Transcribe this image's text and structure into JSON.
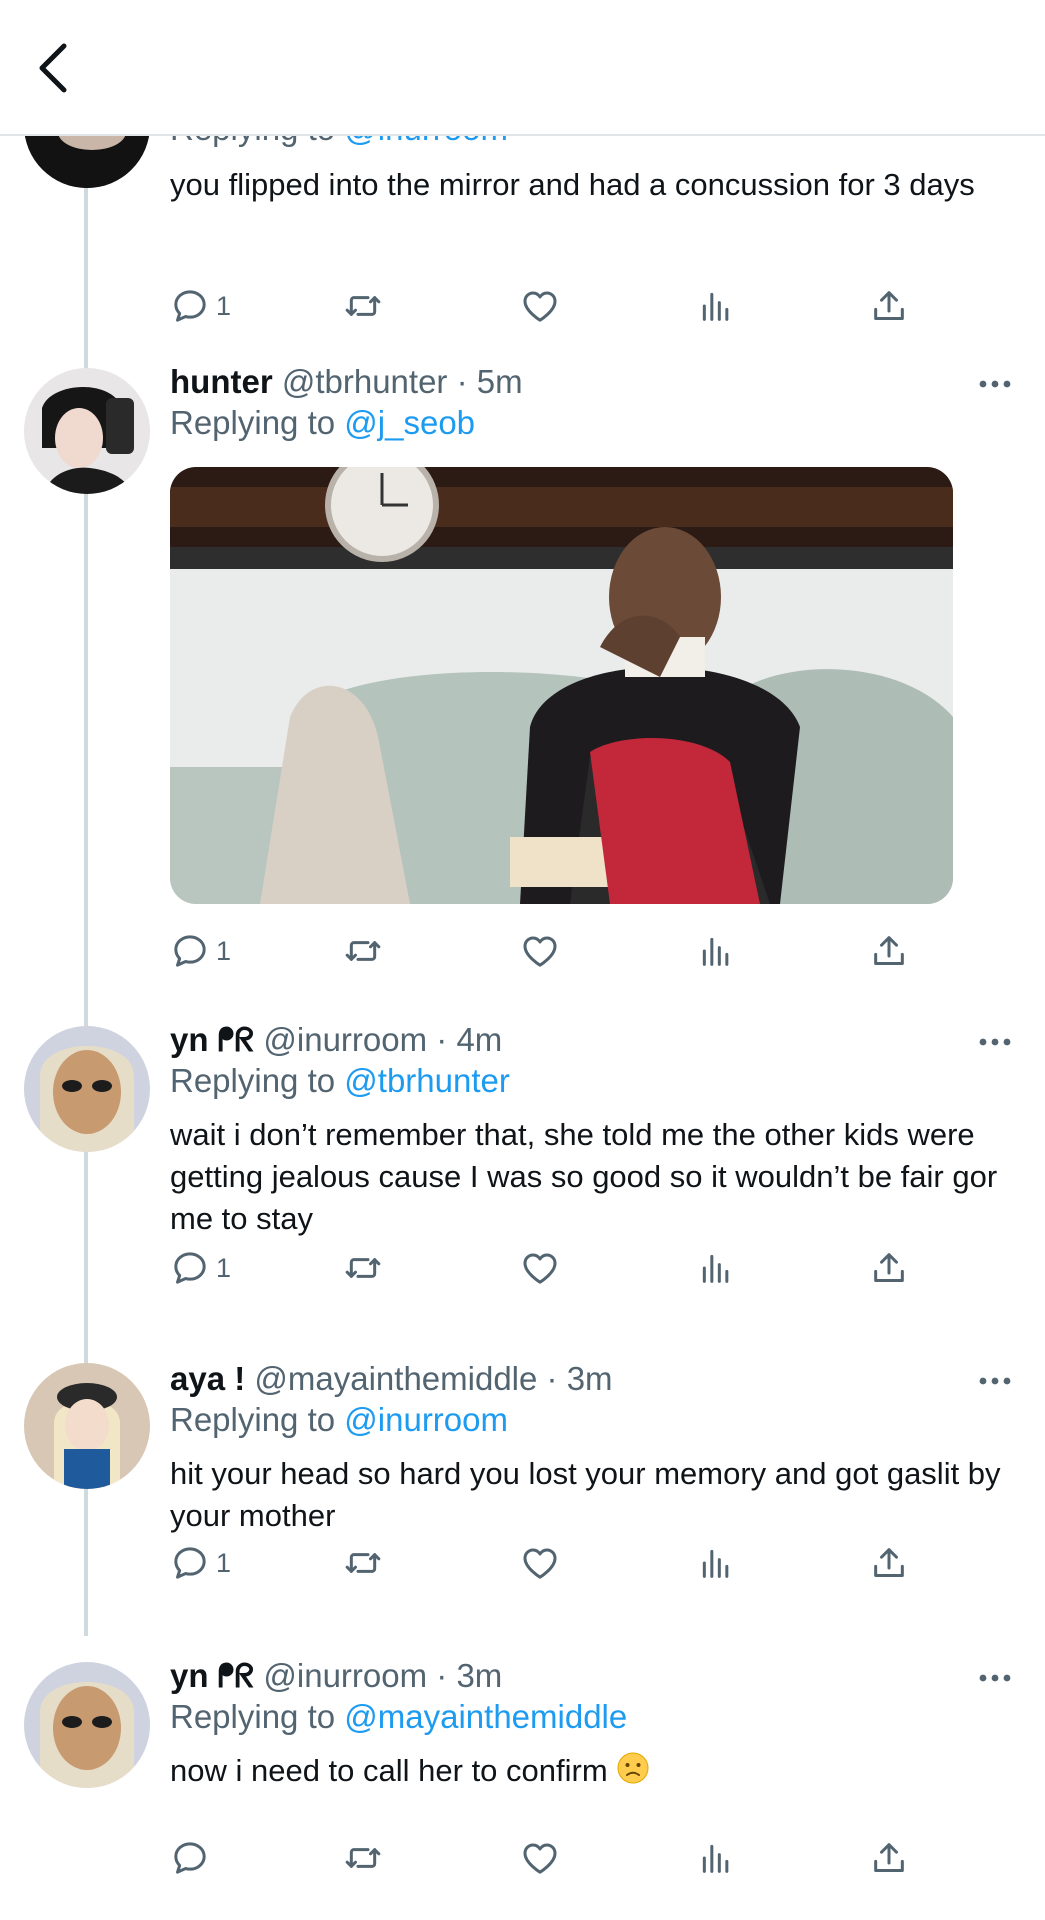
{
  "tweets": [
    {
      "reply_prefix": "Replying to",
      "reply_handle": "@inurroom",
      "text": "you flipped into the mirror and had a concussion for 3 days",
      "reply_count": "1"
    },
    {
      "name": "hunter",
      "handle": "@tbrhunter",
      "time": "· 5m",
      "reply_prefix": "Replying to",
      "reply_handle": "@j_seob",
      "reply_count": "1"
    },
    {
      "name": "yn ᖰᖇ",
      "handle": "@inurroom",
      "time": "· 4m",
      "reply_prefix": "Replying to",
      "reply_handle": "@tbrhunter",
      "text": "wait i don’t remember that, she told me the other kids were getting jealous cause I was so good so it wouldn’t be fair gor me to stay",
      "reply_count": "1"
    },
    {
      "name": "aya !",
      "handle": "@mayainthemiddle",
      "time": "· 3m",
      "reply_prefix": "Replying to",
      "reply_handle": "@inurroom",
      "text": "hit your head so hard you lost your memory and got gaslit by your mother",
      "reply_count": "1"
    },
    {
      "name": "yn ᖰᖇ",
      "handle": "@inurroom",
      "time": "· 3m",
      "reply_prefix": "Replying to",
      "reply_handle": "@mayainthemiddle",
      "text": "now i need to call her to confirm",
      "reply_count": ""
    }
  ],
  "colors": {
    "link": "#1d9bf0",
    "muted": "#536471",
    "text": "#0f1419",
    "thread_line": "#cfd9de"
  },
  "icons": [
    "back-arrow-icon",
    "reply-icon",
    "retweet-icon",
    "like-icon",
    "views-icon",
    "share-icon",
    "more-icon",
    "confused-face-emoji"
  ]
}
